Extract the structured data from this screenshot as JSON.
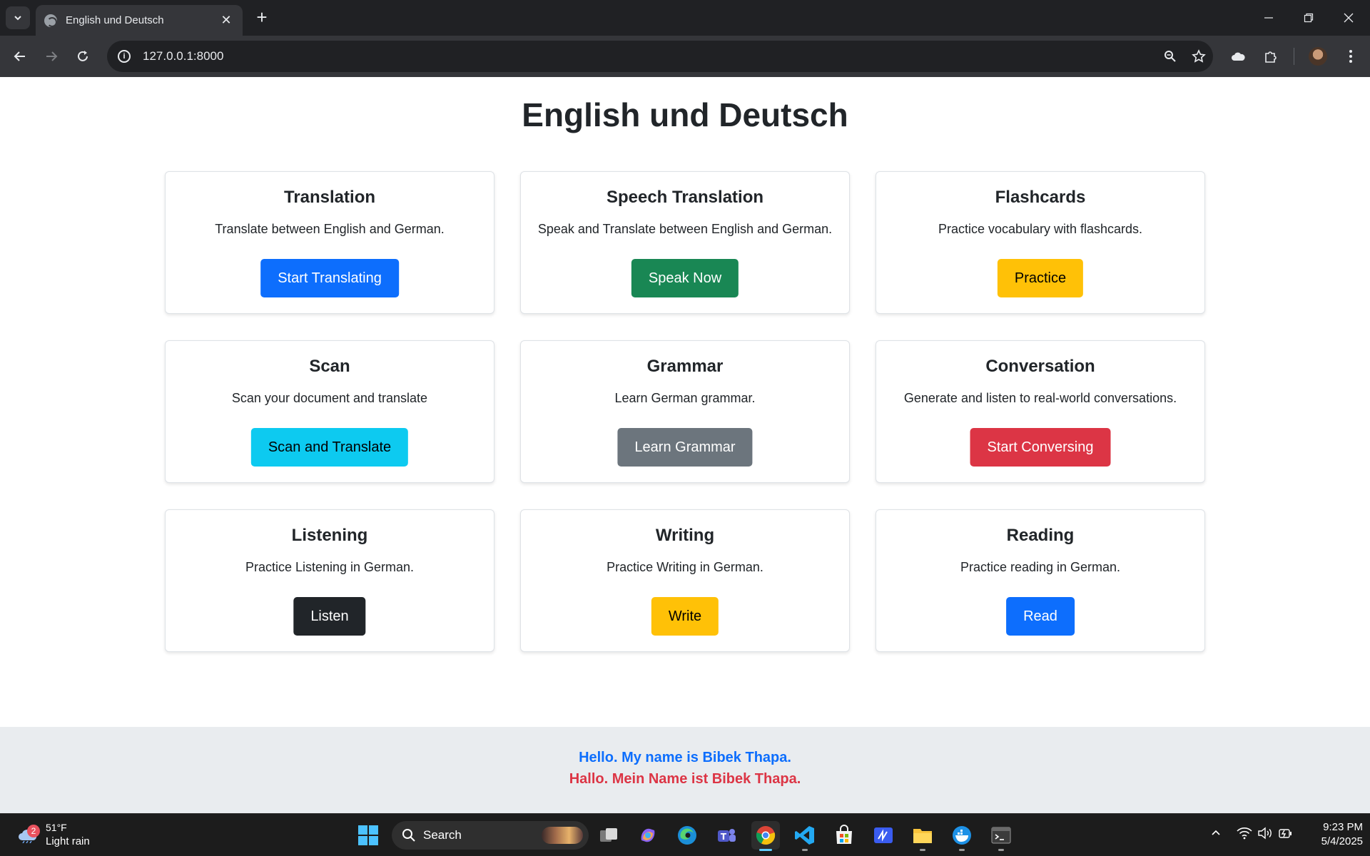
{
  "browser": {
    "tab_title": "English und Deutsch",
    "url": "127.0.0.1:8000"
  },
  "page": {
    "title": "English und Deutsch",
    "cards": [
      {
        "title": "Translation",
        "description": "Translate between English and German.",
        "button": "Start Translating",
        "button_color": "#0d6efd",
        "button_text_color": "#ffffff"
      },
      {
        "title": "Speech Translation",
        "description": "Speak and Translate between English and German.",
        "button": "Speak Now",
        "button_color": "#198754",
        "button_text_color": "#ffffff"
      },
      {
        "title": "Flashcards",
        "description": "Practice vocabulary with flashcards.",
        "button": "Practice",
        "button_color": "#ffc107",
        "button_text_color": "#000000"
      },
      {
        "title": "Scan",
        "description": "Scan your document and translate",
        "button": "Scan and Translate",
        "button_color": "#0dcaf0",
        "button_text_color": "#000000"
      },
      {
        "title": "Grammar",
        "description": "Learn German grammar.",
        "button": "Learn Grammar",
        "button_color": "#6c757d",
        "button_text_color": "#ffffff"
      },
      {
        "title": "Conversation",
        "description": "Generate and listen to real-world conversations.",
        "button": "Start Conversing",
        "button_color": "#dc3545",
        "button_text_color": "#ffffff"
      },
      {
        "title": "Listening",
        "description": "Practice Listening in German.",
        "button": "Listen",
        "button_color": "#212529",
        "button_text_color": "#ffffff"
      },
      {
        "title": "Writing",
        "description": "Practice Writing in German.",
        "button": "Write",
        "button_color": "#ffc107",
        "button_text_color": "#000000"
      },
      {
        "title": "Reading",
        "description": "Practice reading in German.",
        "button": "Read",
        "button_color": "#0d6efd",
        "button_text_color": "#ffffff"
      }
    ]
  },
  "footer": {
    "english": "Hello. My name is Bibek Thapa.",
    "german": "Hallo. Mein Name ist Bibek Thapa.",
    "english_color": "#0d6efd",
    "german_color": "#dc3545"
  },
  "taskbar": {
    "weather_badge": "2",
    "temperature": "51°F",
    "condition": "Light rain",
    "search_label": "Search",
    "time": "9:23 PM",
    "date": "5/4/2025"
  }
}
